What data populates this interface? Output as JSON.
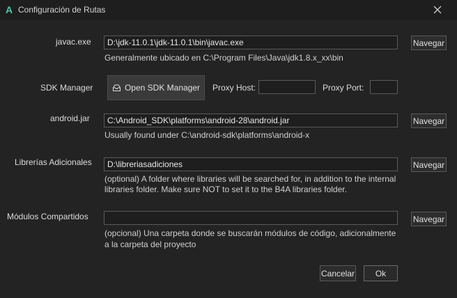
{
  "window": {
    "title": "Configuración de Rutas",
    "app_letter": "A"
  },
  "javac": {
    "label": "javac.exe",
    "value": "D:\\jdk-11.0.1\\jdk-11.0.1\\bin\\javac.exe",
    "hint": "Generalmente ubicado en C:\\Program Files\\Java\\jdk1.8.x_xx\\bin",
    "browse": "Navegar"
  },
  "sdk": {
    "label": "SDK Manager",
    "button": "Open SDK Manager",
    "proxy_host_label": "Proxy Host:",
    "proxy_host_value": "",
    "proxy_port_label": "Proxy Port:",
    "proxy_port_value": ""
  },
  "android_jar": {
    "label": "android.jar",
    "value": "C:\\Android_SDK\\platforms\\android-28\\android.jar",
    "hint": "Usually found under C:\\android-sdk\\platforms\\android-x",
    "browse": "Navegar"
  },
  "libraries": {
    "label": "Librerías Adicionales",
    "value": "D:\\libreriasadiciones",
    "hint_line1": "(optional) A folder where libraries will be searched for, in addition to the internal",
    "hint_line2": "libraries folder. Make sure NOT to set it to the B4A libraries folder.",
    "browse": "Navegar"
  },
  "shared_modules": {
    "label": "Módulos Compartidos",
    "value": "",
    "hint_line1": "(opcional) Una carpeta donde se buscarán módulos de código, adicionalmente",
    "hint_line2": "a la carpeta del proyecto",
    "browse": "Navegar"
  },
  "footer": {
    "cancel": "Cancelar",
    "ok": "Ok"
  },
  "colors": {
    "accent": "#4ec9b0",
    "background": "#232323",
    "titlebar": "#1e1e1e"
  }
}
